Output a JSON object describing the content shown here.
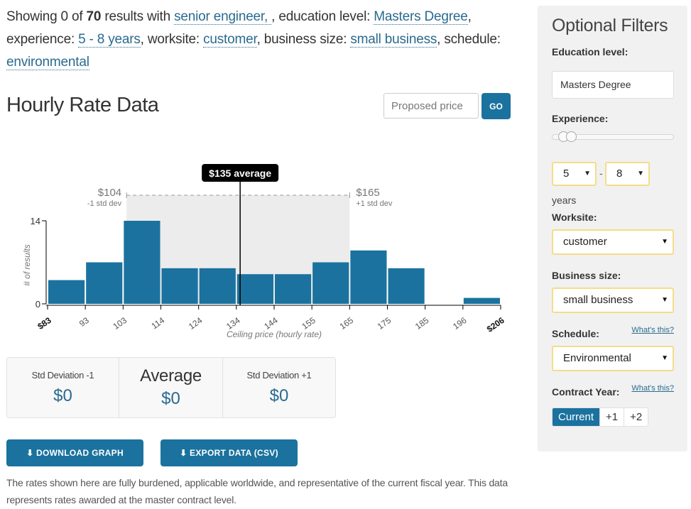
{
  "summary": {
    "prefix": "Showing 0 of ",
    "total": "70",
    "p1": " results with ",
    "query": "senior engineer, ",
    "p2": ", education level: ",
    "education": "Masters Degree",
    "p3": ", experience: ",
    "experience": "5 - 8 years",
    "p4": ", worksite: ",
    "worksite": "customer",
    "p5": ", business size: ",
    "business_size": "small business",
    "p6": ", schedule: ",
    "schedule": "environmental"
  },
  "title": "Hourly Rate Data",
  "proposed_price": {
    "placeholder": "Proposed price",
    "value": ""
  },
  "go_label": "GO",
  "chart_data": {
    "type": "bar",
    "title": "",
    "xlabel": "Ceiling price (hourly rate)",
    "ylabel": "# of results",
    "bin_edges": [
      83,
      93,
      103,
      114,
      124,
      134,
      144,
      155,
      165,
      175,
      185,
      196,
      206
    ],
    "tick_labels": [
      "$83",
      "93",
      "103",
      "114",
      "124",
      "134",
      "144",
      "155",
      "165",
      "175",
      "185",
      "196",
      "$206"
    ],
    "values": [
      4,
      7,
      14,
      6,
      6,
      5,
      5,
      7,
      9,
      6,
      0,
      1
    ],
    "ylim": [
      0,
      14
    ],
    "y_ticks": [
      "0",
      "14"
    ],
    "average": {
      "value": 135,
      "label": "$135 average"
    },
    "minus_std": {
      "value": 104,
      "label": "$104",
      "sub": "-1 std dev"
    },
    "plus_std": {
      "value": 165,
      "label": "$165",
      "sub": "+1 std dev"
    },
    "colors": {
      "bar": "#1b729e",
      "std_band": "#ececec",
      "avg_line": "#000000"
    },
    "grid": false,
    "legend": "none"
  },
  "stats": [
    {
      "label": "Std Deviation -1",
      "value": "$0"
    },
    {
      "label": "Average",
      "value": "$0"
    },
    {
      "label": "Std Deviation +1",
      "value": "$0"
    }
  ],
  "buttons": {
    "download_graph": "⬇ DOWNLOAD GRAPH",
    "export_csv": "⬇ EXPORT DATA (CSV)"
  },
  "note": "The rates shown here are fully burdened, applicable worldwide, and representative of the current fiscal year. This data represents rates awarded at the master contract level.",
  "sidebar": {
    "title": "Optional Filters",
    "education_label": "Education level:",
    "education_value": "Masters Degree",
    "experience_label": "Experience:",
    "experience_min": "5",
    "experience_max": "8",
    "experience_sep": "-",
    "experience_range": {
      "min": 0,
      "max": 45,
      "low": 5,
      "high": 8
    },
    "years_label": "years",
    "worksite_label": "Worksite:",
    "worksite_value": "customer",
    "business_size_label": "Business size:",
    "business_size_value": "small business",
    "schedule_label": "Schedule:",
    "schedule_value": "Environmental",
    "whats_this": "What's this?",
    "contract_year_label": "Contract Year:",
    "contract_years": [
      "Current",
      "+1",
      "+2"
    ],
    "contract_year_active": 0,
    "arrow": "▼"
  }
}
